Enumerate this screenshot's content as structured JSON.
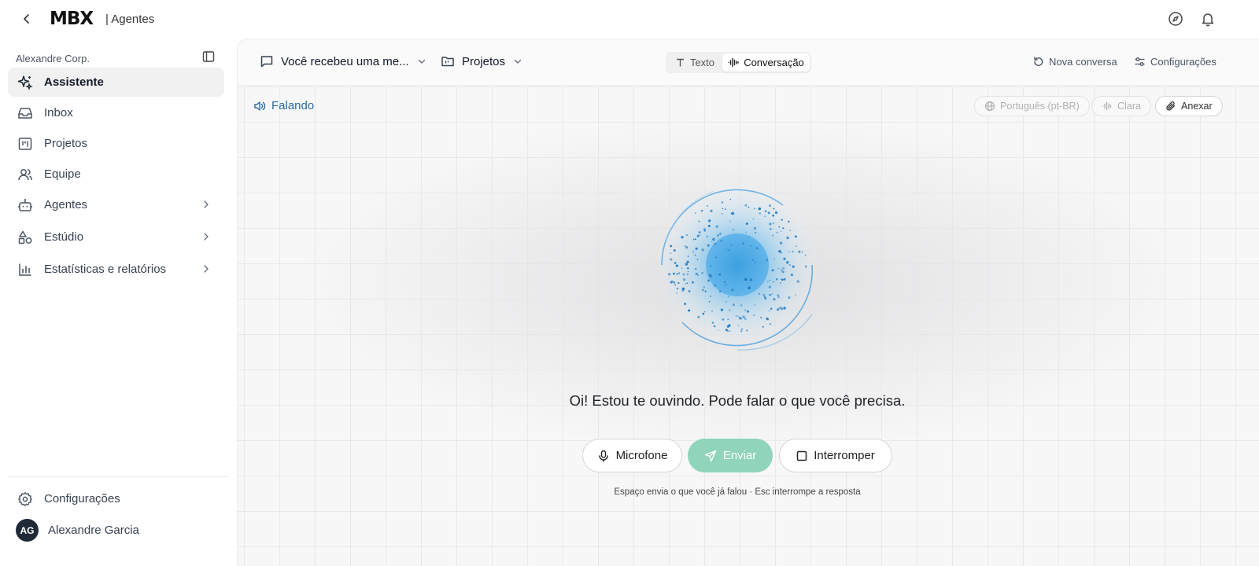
{
  "app": {
    "logo": "MBX",
    "section": "| Agentes"
  },
  "sidebar": {
    "org": "Alexandre Corp.",
    "items": [
      {
        "label": "Assistente",
        "icon": "sparkles-icon",
        "active": true
      },
      {
        "label": "Inbox",
        "icon": "inbox-icon"
      },
      {
        "label": "Projetos",
        "icon": "kanban-icon"
      },
      {
        "label": "Equipe",
        "icon": "users-icon"
      },
      {
        "label": "Agentes",
        "icon": "bot-icon",
        "expandable": true
      },
      {
        "label": "Estúdio",
        "icon": "shapes-icon",
        "expandable": true
      },
      {
        "label": "Estatísticas e relatórios",
        "icon": "bar-chart-icon",
        "expandable": true
      }
    ],
    "settings": "Configurações",
    "user": {
      "initials": "AG",
      "name": "Alexandre Garcia"
    }
  },
  "header": {
    "conversation": "Você recebeu uma me...",
    "project": "Projetos",
    "modes": {
      "text": "Texto",
      "voice": "Conversação"
    },
    "new_chat": "Nova conversa",
    "settings": "Configurações"
  },
  "voice": {
    "status": "Falando",
    "language": "Português (pt-BR)",
    "voice_name": "Clara",
    "attach": "Anexar",
    "message": "Oi! Estou te ouvindo. Pode falar o que você precisa.",
    "mic": "Microfone",
    "send": "Enviar",
    "stop": "Interromper",
    "hint": "Espaço envia o que você já falou · Esc interrompe a resposta"
  },
  "colors": {
    "accent_blue": "#2b6aa3",
    "send_green": "#8fd4bb",
    "orb_blue": "#3aa0e0"
  }
}
